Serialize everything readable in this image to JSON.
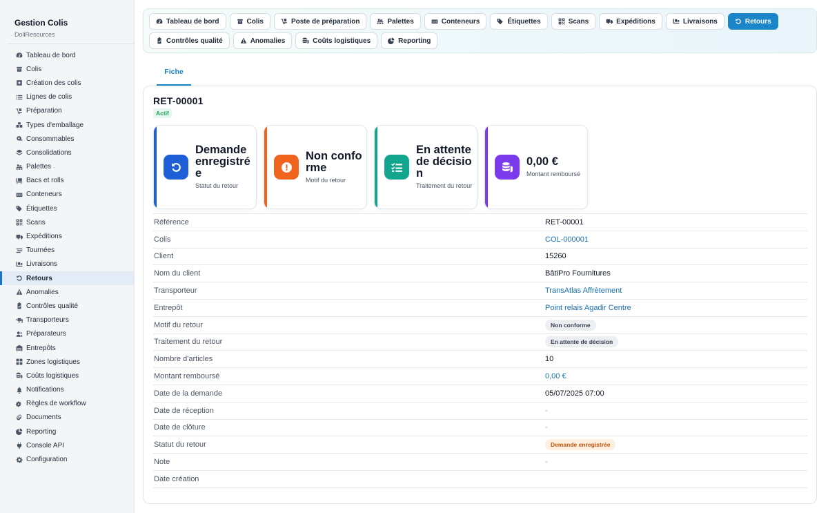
{
  "app": {
    "title": "Gestion Colis",
    "subtitle": "DoliResources"
  },
  "sidebar": {
    "items": [
      {
        "label": "Tableau de bord",
        "icon": "gauge-icon"
      },
      {
        "label": "Colis",
        "icon": "box-icon"
      },
      {
        "label": "Création des colis",
        "icon": "plus-square-icon"
      },
      {
        "label": "Lignes de colis",
        "icon": "list-icon"
      },
      {
        "label": "Préparation",
        "icon": "dolly-icon"
      },
      {
        "label": "Types d'emballage",
        "icon": "boxes-icon"
      },
      {
        "label": "Consommables",
        "icon": "tape-icon"
      },
      {
        "label": "Consolidations",
        "icon": "layers-icon"
      },
      {
        "label": "Palettes",
        "icon": "pallet-icon"
      },
      {
        "label": "Bacs et rolls",
        "icon": "dolly-flatbed-icon"
      },
      {
        "label": "Conteneurs",
        "icon": "container-icon"
      },
      {
        "label": "Étiquettes",
        "icon": "tags-icon"
      },
      {
        "label": "Scans",
        "icon": "qrcode-icon"
      },
      {
        "label": "Expéditions",
        "icon": "truck-icon"
      },
      {
        "label": "Tournées",
        "icon": "route-icon"
      },
      {
        "label": "Livraisons",
        "icon": "truck-loading-icon"
      },
      {
        "label": "Retours",
        "icon": "undo-icon",
        "active": true
      },
      {
        "label": "Anomalies",
        "icon": "warning-icon"
      },
      {
        "label": "Contrôles qualité",
        "icon": "clipboard-check-icon"
      },
      {
        "label": "Transporteurs",
        "icon": "shipping-fast-icon"
      },
      {
        "label": "Préparateurs",
        "icon": "users-icon"
      },
      {
        "label": "Entrepôts",
        "icon": "warehouse-icon"
      },
      {
        "label": "Zones logistiques",
        "icon": "grid-icon"
      },
      {
        "label": "Coûts logistiques",
        "icon": "coins-icon"
      },
      {
        "label": "Notifications",
        "icon": "bell-icon"
      },
      {
        "label": "Règles de workflow",
        "icon": "cogs-icon"
      },
      {
        "label": "Documents",
        "icon": "paperclip-icon"
      },
      {
        "label": "Reporting",
        "icon": "chart-pie-icon"
      },
      {
        "label": "Console API",
        "icon": "plug-icon"
      },
      {
        "label": "Configuration",
        "icon": "gear-icon"
      }
    ]
  },
  "topnav": {
    "row1": [
      {
        "label": "Tableau de bord",
        "icon": "gauge-icon"
      },
      {
        "label": "Colis",
        "icon": "box-icon"
      },
      {
        "label": "Poste de préparation",
        "icon": "dolly-icon"
      },
      {
        "label": "Palettes",
        "icon": "pallet-icon"
      },
      {
        "label": "Conteneurs",
        "icon": "container-icon"
      },
      {
        "label": "Étiquettes",
        "icon": "tags-icon"
      },
      {
        "label": "Scans",
        "icon": "qrcode-icon"
      },
      {
        "label": "Expéditions",
        "icon": "truck-icon"
      },
      {
        "label": "Livraisons",
        "icon": "truck-loading-icon"
      },
      {
        "label": "Retours",
        "icon": "undo-icon",
        "active": true
      }
    ],
    "row2": [
      {
        "label": "Contrôles qualité",
        "icon": "clipboard-check-icon"
      },
      {
        "label": "Anomalies",
        "icon": "warning-icon"
      },
      {
        "label": "Coûts logistiques",
        "icon": "coins-icon"
      },
      {
        "label": "Reporting",
        "icon": "chart-pie-icon"
      }
    ]
  },
  "subtab": {
    "label": "Fiche"
  },
  "record": {
    "ref": "RET-00001",
    "status_badge": "Actif",
    "kpis": [
      {
        "value": "Demande enregistrée",
        "label": "Statut du retour",
        "color": "#1e5fd8",
        "icon": "undo-icon"
      },
      {
        "value": "Non conforme",
        "label": "Motif du retour",
        "color": "#f0641e",
        "icon": "exclamation-icon"
      },
      {
        "value": "En attente de décision",
        "label": "Traitement du retour",
        "color": "#14a58e",
        "icon": "tasks-icon"
      },
      {
        "value": "0,00 €",
        "label": "Montant remboursé",
        "color": "#7c3aed",
        "icon": "coins-icon"
      }
    ],
    "fields": [
      {
        "label": "Référence",
        "value": "RET-00001",
        "kind": "text"
      },
      {
        "label": "Colis",
        "value": "COL-000001",
        "kind": "link"
      },
      {
        "label": "Client",
        "value": "15260",
        "kind": "text"
      },
      {
        "label": "Nom du client",
        "value": "BâtiPro Fournitures",
        "kind": "text"
      },
      {
        "label": "Transporteur",
        "value": "TransAtlas Affrètement",
        "kind": "link"
      },
      {
        "label": "Entrepôt",
        "value": "Point relais Agadir Centre",
        "kind": "link"
      },
      {
        "label": "Motif du retour",
        "value": "Non conforme",
        "kind": "pill-grey"
      },
      {
        "label": "Traitement du retour",
        "value": "En attente de décision",
        "kind": "pill-grey"
      },
      {
        "label": "Nombre d'articles",
        "value": "10",
        "kind": "text"
      },
      {
        "label": "Montant remboursé",
        "value": "0,00 €",
        "kind": "money"
      },
      {
        "label": "Date de la demande",
        "value": "05/07/2025 07:00",
        "kind": "text"
      },
      {
        "label": "Date de réception",
        "value": "-",
        "kind": "dash"
      },
      {
        "label": "Date de clôture",
        "value": "-",
        "kind": "dash"
      },
      {
        "label": "Statut du retour",
        "value": "Demande enregistrée",
        "kind": "pill-orange"
      },
      {
        "label": "Note",
        "value": "-",
        "kind": "dash"
      },
      {
        "label": "Date création",
        "value": "",
        "kind": "text"
      }
    ]
  },
  "colors": {
    "accent": "#1a86c9",
    "active_bg": "#e3ecf6"
  }
}
